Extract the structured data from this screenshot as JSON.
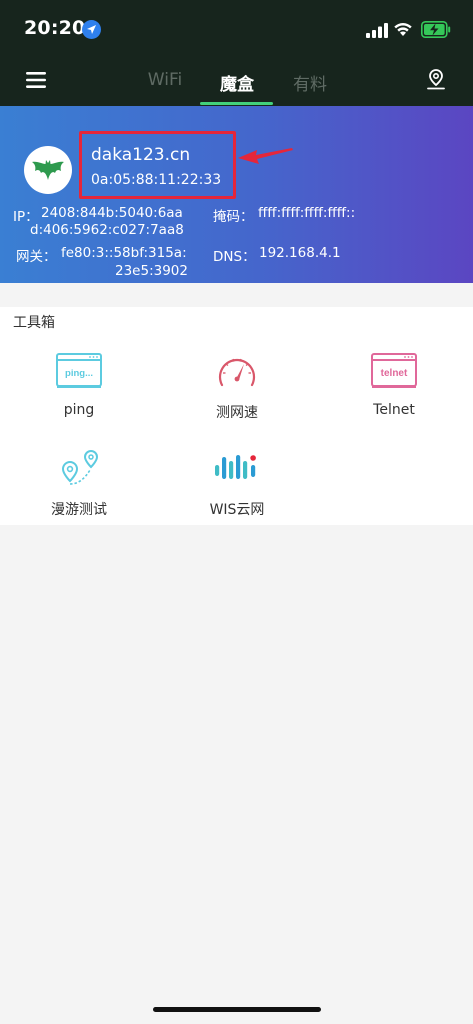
{
  "status_bar": {
    "time": "20:20",
    "icons": [
      "location-arrow-icon",
      "cellular-signal-icon",
      "wifi-icon",
      "battery-charging-icon"
    ]
  },
  "nav": {
    "menu_icon": "hamburger-menu-icon",
    "tabs": [
      {
        "label": "WiFi",
        "active": false
      },
      {
        "label": "魔盒",
        "active": true
      },
      {
        "label": "有料",
        "active": false
      }
    ],
    "right_icon": "map-pin-icon"
  },
  "device": {
    "name": "daka123.cn",
    "mac": "0a:05:88:11:22:33",
    "ip_label": "IP：",
    "ip_line1": "2408:844b:5040:6aa",
    "ip_line2": "d:406:5962:c027:7aa8",
    "mask_label": "掩码：",
    "mask_value": "ffff:ffff:ffff:ffff::",
    "gateway_label": "网关：",
    "gateway_line1": "fe80:3::58bf:315a:",
    "gateway_line2": "23e5:3902",
    "dns_label": "DNS：",
    "dns_value": "192.168.4.1"
  },
  "toolbox": {
    "title": "工具箱",
    "tools": [
      {
        "label": "ping",
        "icon": "ping-icon",
        "icon_text": "ping..."
      },
      {
        "label": "测网速",
        "icon": "speedometer-icon"
      },
      {
        "label": "Telnet",
        "icon": "telnet-icon",
        "icon_text": "telnet"
      },
      {
        "label": "漫游测试",
        "icon": "roaming-pins-icon"
      },
      {
        "label": "WIS云网",
        "icon": "wis-logo-icon"
      }
    ]
  },
  "colors": {
    "header_bg": "#17251d",
    "tab_underline": "#43d17b",
    "card_gradient_start": "#3a7fd3",
    "card_gradient_end": "#5b46c2",
    "highlight_red": "#e5263a"
  }
}
